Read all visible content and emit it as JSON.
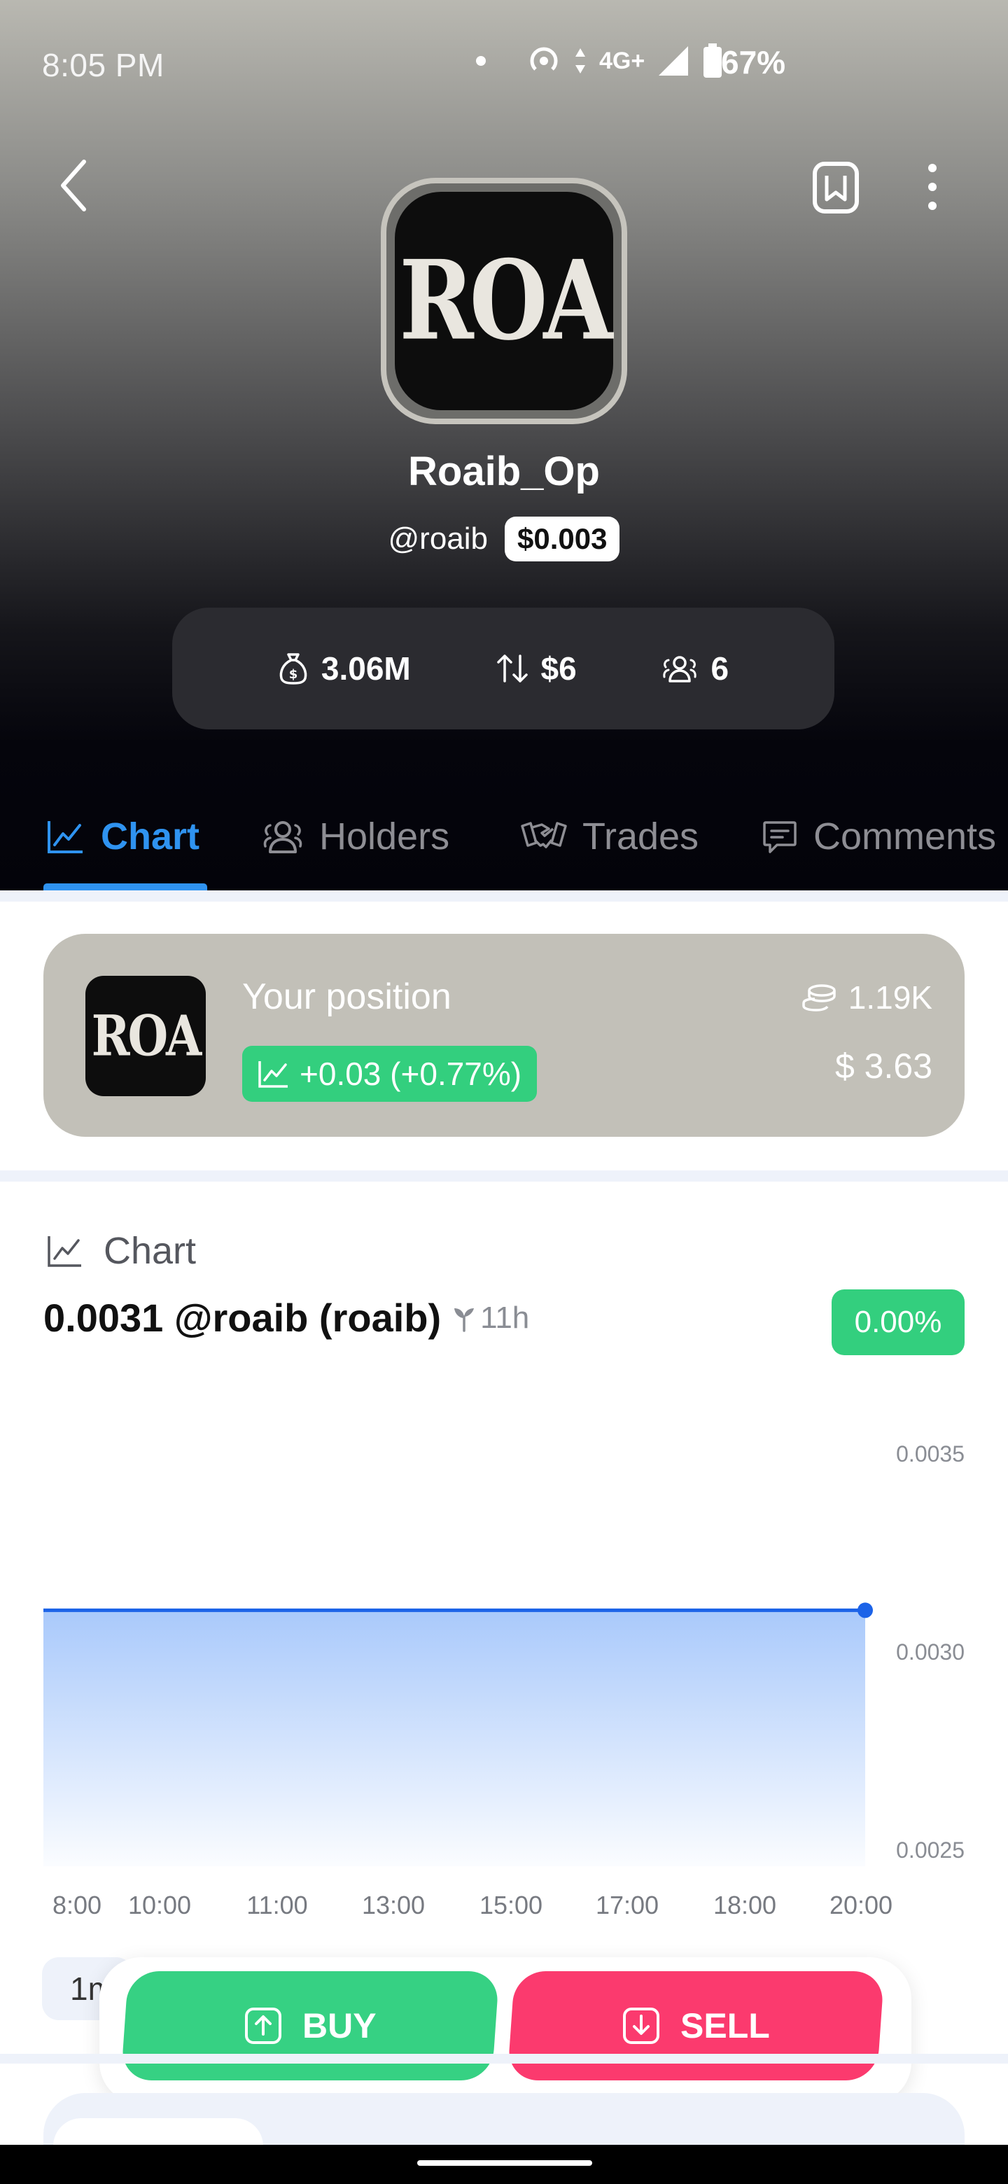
{
  "status_bar": {
    "time": "8:05 PM",
    "network": "4G+",
    "battery": "67%"
  },
  "profile": {
    "logo_text": "ROA",
    "name": "Roaib_Op",
    "handle": "@roaib",
    "price": "$0.003"
  },
  "stats": {
    "market_cap": "3.06M",
    "volume": "$6",
    "holders": "6"
  },
  "tabs": [
    {
      "label": "Chart",
      "active": true,
      "icon": "chart-icon"
    },
    {
      "label": "Holders",
      "active": false,
      "icon": "holders-icon"
    },
    {
      "label": "Trades",
      "active": false,
      "icon": "handshake-icon"
    },
    {
      "label": "Comments",
      "active": false,
      "icon": "comment-icon"
    }
  ],
  "position": {
    "logo_text": "ROA",
    "title": "Your position",
    "change": "+0.03 (+0.77%)",
    "quantity": "1.19K",
    "value": "$ 3.63"
  },
  "chart_section": {
    "heading": "Chart",
    "title": "0.0031 @roaib (roaib)",
    "age": "11h",
    "change": "0.00%"
  },
  "chart_data": {
    "type": "area",
    "x": [
      "8:00",
      "10:00",
      "11:00",
      "13:00",
      "15:00",
      "17:00",
      "18:00",
      "20:00"
    ],
    "values": [
      0.0031,
      0.0031,
      0.0031,
      0.0031,
      0.0031,
      0.0031,
      0.0031,
      0.0031
    ],
    "y_ticks": [
      "0.0035",
      "0.0030",
      "0.0025"
    ],
    "ylim": [
      0.0025,
      0.0035
    ],
    "title": "",
    "xlabel": "",
    "ylabel": "",
    "line_color": "#1c63e8",
    "fill_color": "#a9c9fb"
  },
  "range_selector": {
    "selected": "1m"
  },
  "actions": {
    "buy": "BUY",
    "sell": "SELL"
  },
  "colors": {
    "accent": "#2f93f0",
    "positive": "#33cf7e",
    "negative": "#fb3a6e"
  }
}
